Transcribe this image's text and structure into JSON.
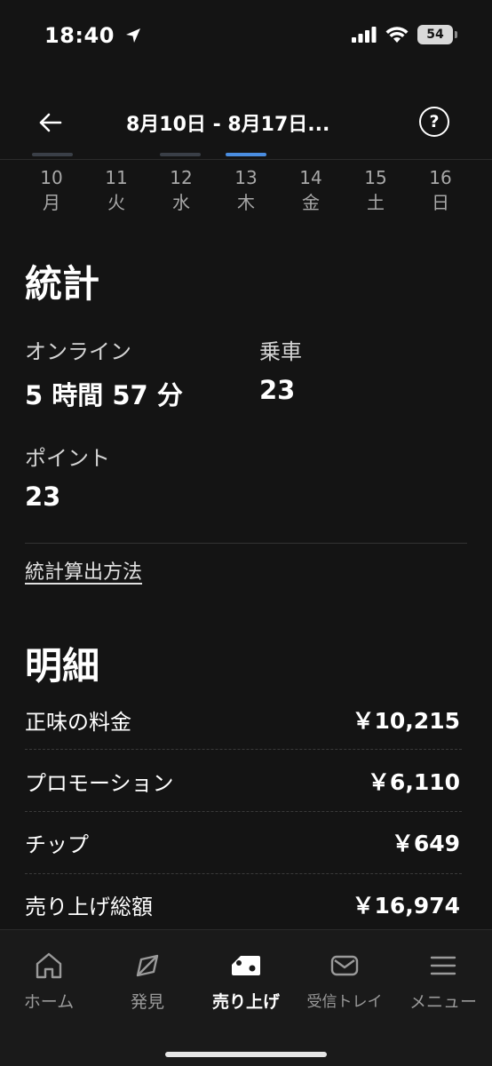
{
  "status_bar": {
    "time": "18:40",
    "battery": "54"
  },
  "header": {
    "title": "8月10日 - 8月17日..."
  },
  "days": [
    {
      "num": "10",
      "weekday": "月"
    },
    {
      "num": "11",
      "weekday": "火"
    },
    {
      "num": "12",
      "weekday": "水"
    },
    {
      "num": "13",
      "weekday": "木"
    },
    {
      "num": "14",
      "weekday": "金"
    },
    {
      "num": "15",
      "weekday": "土"
    },
    {
      "num": "16",
      "weekday": "日"
    }
  ],
  "stats": {
    "title": "統計",
    "online_label": "オンライン",
    "online_value": "5 時間 57 分",
    "trips_label": "乗車",
    "trips_value": "23",
    "points_label": "ポイント",
    "points_value": "23",
    "method_link": "統計算出方法"
  },
  "breakdown": {
    "title": "明細",
    "rows": [
      {
        "label": "正味の料金",
        "value": "￥10,215"
      },
      {
        "label": "プロモーション",
        "value": "￥6,110"
      },
      {
        "label": "チップ",
        "value": "￥649"
      },
      {
        "label": "売り上げ総額",
        "value": "￥16,974"
      }
    ]
  },
  "nav": {
    "items": [
      {
        "label": "ホーム",
        "icon": "home-icon"
      },
      {
        "label": "発見",
        "icon": "compass-icon"
      },
      {
        "label": "売り上げ",
        "icon": "earnings-icon"
      },
      {
        "label": "受信トレイ",
        "icon": "mail-icon"
      },
      {
        "label": "メニュー",
        "icon": "menu-icon"
      }
    ],
    "active_index": 2
  },
  "colors": {
    "background": "#141414",
    "accent": "#4a8de0",
    "nav_background": "#1a1a1a"
  }
}
